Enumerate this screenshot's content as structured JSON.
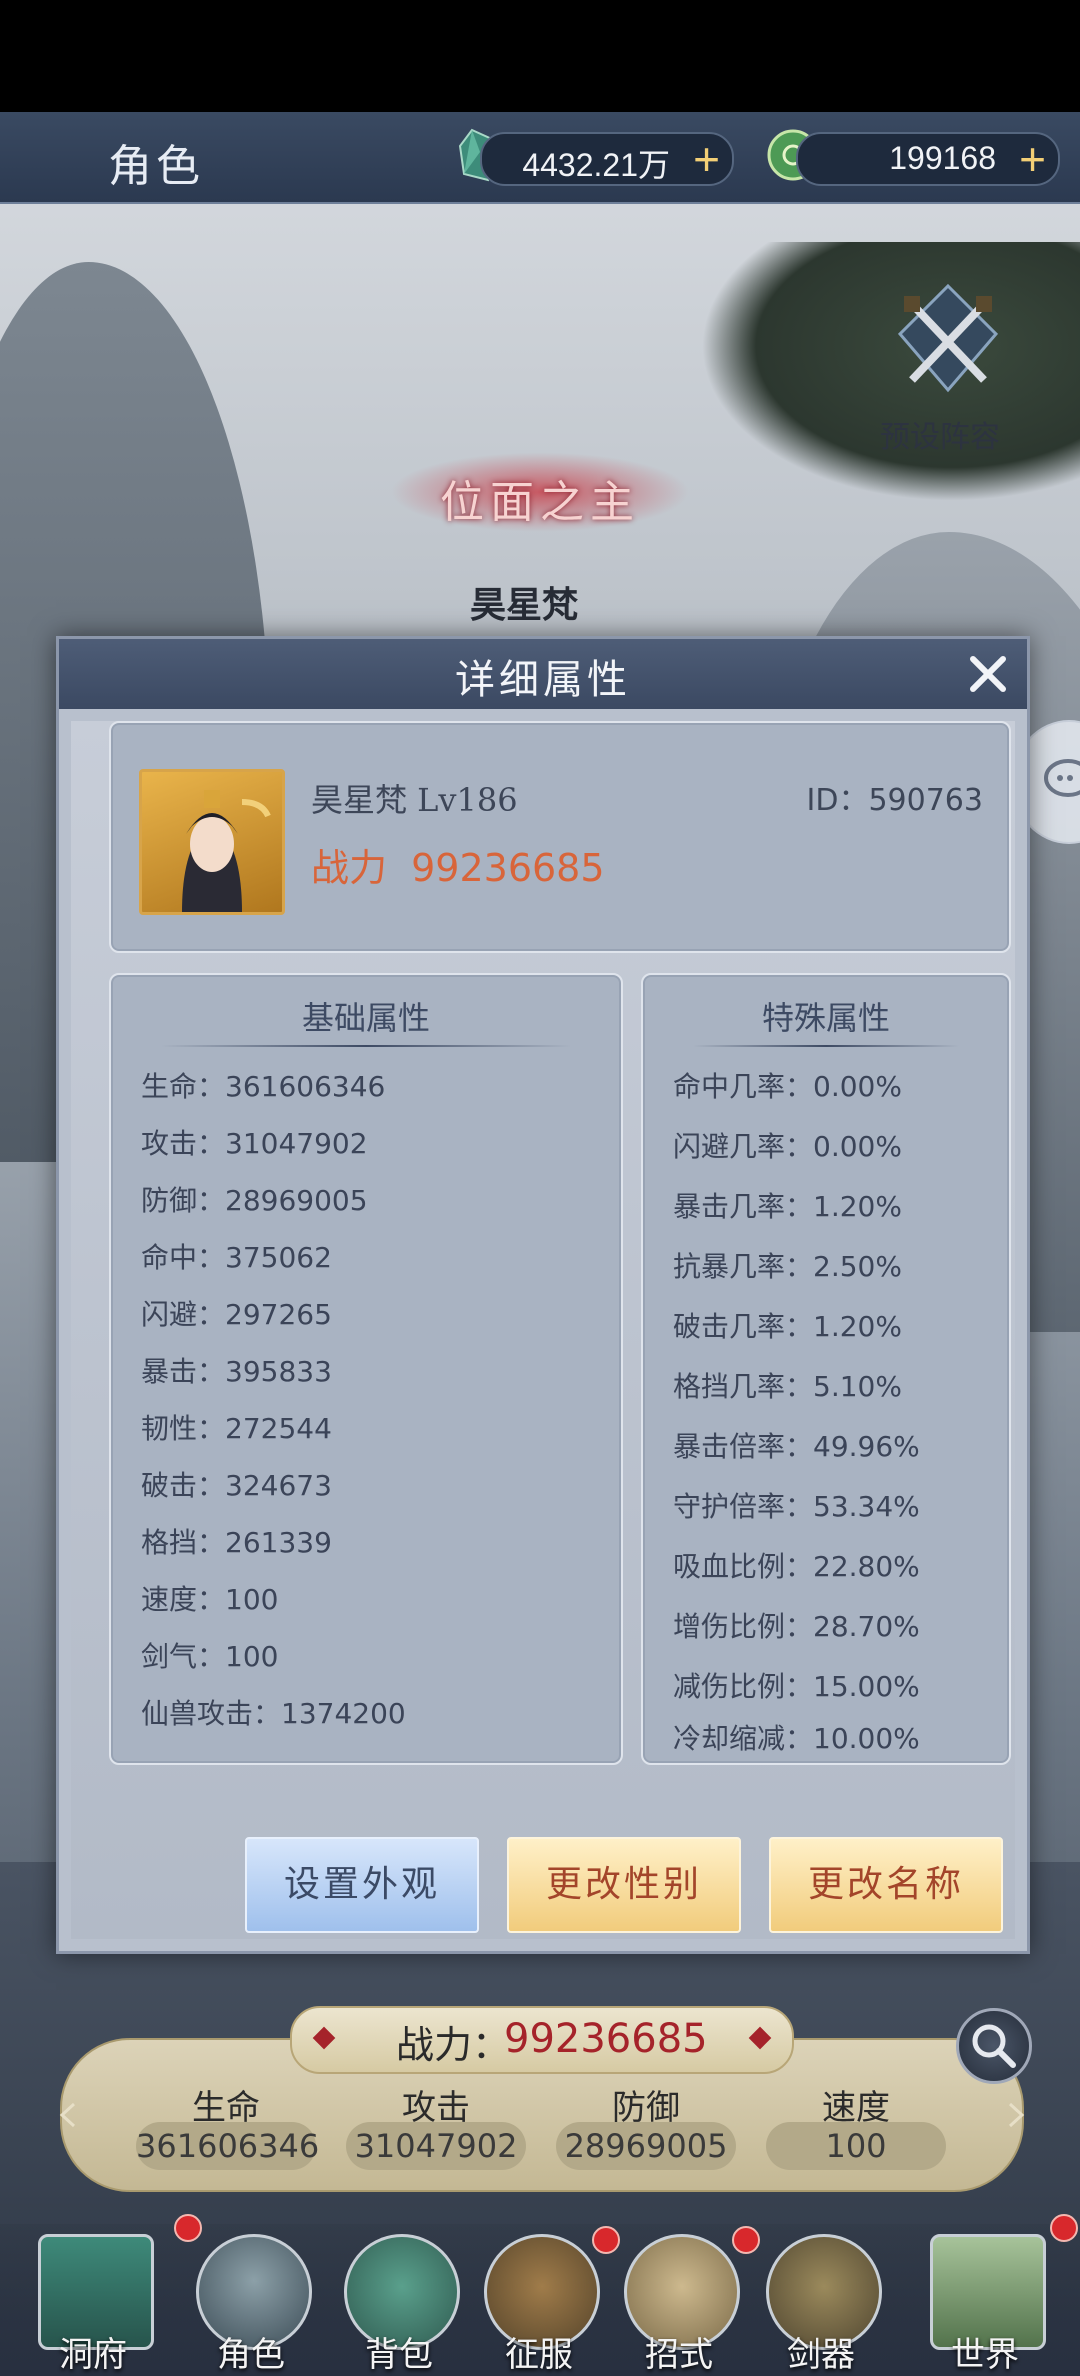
{
  "topbar": {
    "title": "角色",
    "currency1_value": "4432.21万",
    "currency2_value": "199168",
    "plus_symbol": "+"
  },
  "preset": {
    "label": "预设阵容"
  },
  "character": {
    "rank_title": "位面之主",
    "name": "昊星梵"
  },
  "modal": {
    "title": "详细属性",
    "name_level": "昊星梵 Lv186",
    "id": "ID：590763",
    "power_label": "战力",
    "power_value": "99236685",
    "basic_header": "基础属性",
    "special_header": "特殊属性",
    "basic_stats": [
      {
        "label": "生命：",
        "value": "361606346"
      },
      {
        "label": "攻击：",
        "value": "31047902"
      },
      {
        "label": "防御：",
        "value": "28969005"
      },
      {
        "label": "命中：",
        "value": "375062"
      },
      {
        "label": "闪避：",
        "value": "297265"
      },
      {
        "label": "暴击：",
        "value": "395833"
      },
      {
        "label": "韧性：",
        "value": "272544"
      },
      {
        "label": "破击：",
        "value": "324673"
      },
      {
        "label": "格挡：",
        "value": "261339"
      },
      {
        "label": "速度：",
        "value": "100"
      },
      {
        "label": "剑气：",
        "value": "100"
      },
      {
        "label": "仙兽攻击：",
        "value": "1374200"
      }
    ],
    "special_stats": [
      {
        "label": "命中几率：",
        "value": "0.00%"
      },
      {
        "label": "闪避几率：",
        "value": "0.00%"
      },
      {
        "label": "暴击几率：",
        "value": "1.20%"
      },
      {
        "label": "抗暴几率：",
        "value": "2.50%"
      },
      {
        "label": "破击几率：",
        "value": "1.20%"
      },
      {
        "label": "格挡几率：",
        "value": "5.10%"
      },
      {
        "label": "暴击倍率：",
        "value": "49.96%"
      },
      {
        "label": "守护倍率：",
        "value": "53.34%"
      },
      {
        "label": "吸血比例：",
        "value": "22.80%"
      },
      {
        "label": "增伤比例：",
        "value": "28.70%"
      },
      {
        "label": "减伤比例：",
        "value": "15.00%"
      },
      {
        "label": "冷却缩减：",
        "value": "10.00%"
      }
    ],
    "buttons": {
      "appearance": "设置外观",
      "gender": "更改性别",
      "rename": "更改名称"
    }
  },
  "bottom": {
    "power_label": "战力：",
    "power_value": "99236685",
    "stats": [
      {
        "label": "生命",
        "value": "361606346"
      },
      {
        "label": "攻击",
        "value": "31047902"
      },
      {
        "label": "防御",
        "value": "28969005"
      },
      {
        "label": "速度",
        "value": "100"
      }
    ]
  },
  "nav": [
    {
      "label": "洞府",
      "badge": true
    },
    {
      "label": "角色",
      "badge": false
    },
    {
      "label": "背包",
      "badge": false
    },
    {
      "label": "征服",
      "badge": true
    },
    {
      "label": "招式",
      "badge": true
    },
    {
      "label": "剑器",
      "badge": false
    },
    {
      "label": "世界",
      "badge": true
    }
  ],
  "colors": {
    "power_red": "#a5232a",
    "power_orange": "#d8653a",
    "badge_red": "#d8282c"
  }
}
